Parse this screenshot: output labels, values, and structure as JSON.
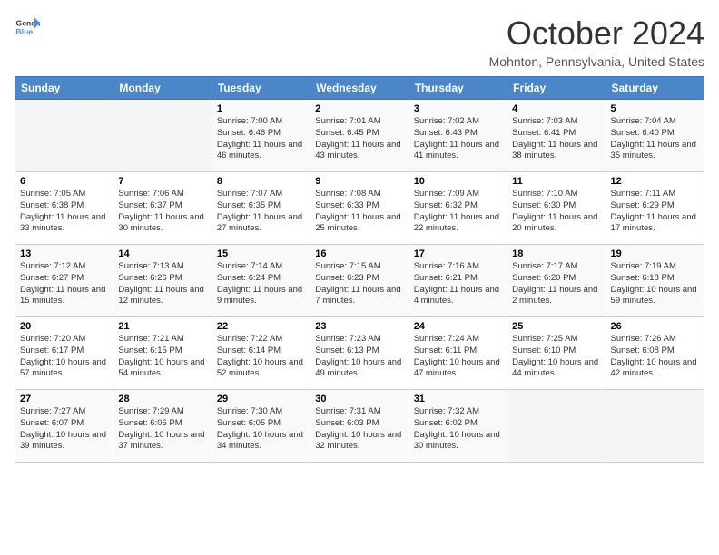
{
  "header": {
    "logo": {
      "general": "General",
      "blue": "Blue"
    },
    "title": "October 2024",
    "location": "Mohnton, Pennsylvania, United States"
  },
  "weekdays": [
    "Sunday",
    "Monday",
    "Tuesday",
    "Wednesday",
    "Thursday",
    "Friday",
    "Saturday"
  ],
  "weeks": [
    [
      {
        "day": null
      },
      {
        "day": null
      },
      {
        "day": "1",
        "sunrise": "Sunrise: 7:00 AM",
        "sunset": "Sunset: 6:46 PM",
        "daylight": "Daylight: 11 hours and 46 minutes."
      },
      {
        "day": "2",
        "sunrise": "Sunrise: 7:01 AM",
        "sunset": "Sunset: 6:45 PM",
        "daylight": "Daylight: 11 hours and 43 minutes."
      },
      {
        "day": "3",
        "sunrise": "Sunrise: 7:02 AM",
        "sunset": "Sunset: 6:43 PM",
        "daylight": "Daylight: 11 hours and 41 minutes."
      },
      {
        "day": "4",
        "sunrise": "Sunrise: 7:03 AM",
        "sunset": "Sunset: 6:41 PM",
        "daylight": "Daylight: 11 hours and 38 minutes."
      },
      {
        "day": "5",
        "sunrise": "Sunrise: 7:04 AM",
        "sunset": "Sunset: 6:40 PM",
        "daylight": "Daylight: 11 hours and 35 minutes."
      }
    ],
    [
      {
        "day": "6",
        "sunrise": "Sunrise: 7:05 AM",
        "sunset": "Sunset: 6:38 PM",
        "daylight": "Daylight: 11 hours and 33 minutes."
      },
      {
        "day": "7",
        "sunrise": "Sunrise: 7:06 AM",
        "sunset": "Sunset: 6:37 PM",
        "daylight": "Daylight: 11 hours and 30 minutes."
      },
      {
        "day": "8",
        "sunrise": "Sunrise: 7:07 AM",
        "sunset": "Sunset: 6:35 PM",
        "daylight": "Daylight: 11 hours and 27 minutes."
      },
      {
        "day": "9",
        "sunrise": "Sunrise: 7:08 AM",
        "sunset": "Sunset: 6:33 PM",
        "daylight": "Daylight: 11 hours and 25 minutes."
      },
      {
        "day": "10",
        "sunrise": "Sunrise: 7:09 AM",
        "sunset": "Sunset: 6:32 PM",
        "daylight": "Daylight: 11 hours and 22 minutes."
      },
      {
        "day": "11",
        "sunrise": "Sunrise: 7:10 AM",
        "sunset": "Sunset: 6:30 PM",
        "daylight": "Daylight: 11 hours and 20 minutes."
      },
      {
        "day": "12",
        "sunrise": "Sunrise: 7:11 AM",
        "sunset": "Sunset: 6:29 PM",
        "daylight": "Daylight: 11 hours and 17 minutes."
      }
    ],
    [
      {
        "day": "13",
        "sunrise": "Sunrise: 7:12 AM",
        "sunset": "Sunset: 6:27 PM",
        "daylight": "Daylight: 11 hours and 15 minutes."
      },
      {
        "day": "14",
        "sunrise": "Sunrise: 7:13 AM",
        "sunset": "Sunset: 6:26 PM",
        "daylight": "Daylight: 11 hours and 12 minutes."
      },
      {
        "day": "15",
        "sunrise": "Sunrise: 7:14 AM",
        "sunset": "Sunset: 6:24 PM",
        "daylight": "Daylight: 11 hours and 9 minutes."
      },
      {
        "day": "16",
        "sunrise": "Sunrise: 7:15 AM",
        "sunset": "Sunset: 6:23 PM",
        "daylight": "Daylight: 11 hours and 7 minutes."
      },
      {
        "day": "17",
        "sunrise": "Sunrise: 7:16 AM",
        "sunset": "Sunset: 6:21 PM",
        "daylight": "Daylight: 11 hours and 4 minutes."
      },
      {
        "day": "18",
        "sunrise": "Sunrise: 7:17 AM",
        "sunset": "Sunset: 6:20 PM",
        "daylight": "Daylight: 11 hours and 2 minutes."
      },
      {
        "day": "19",
        "sunrise": "Sunrise: 7:19 AM",
        "sunset": "Sunset: 6:18 PM",
        "daylight": "Daylight: 10 hours and 59 minutes."
      }
    ],
    [
      {
        "day": "20",
        "sunrise": "Sunrise: 7:20 AM",
        "sunset": "Sunset: 6:17 PM",
        "daylight": "Daylight: 10 hours and 57 minutes."
      },
      {
        "day": "21",
        "sunrise": "Sunrise: 7:21 AM",
        "sunset": "Sunset: 6:15 PM",
        "daylight": "Daylight: 10 hours and 54 minutes."
      },
      {
        "day": "22",
        "sunrise": "Sunrise: 7:22 AM",
        "sunset": "Sunset: 6:14 PM",
        "daylight": "Daylight: 10 hours and 52 minutes."
      },
      {
        "day": "23",
        "sunrise": "Sunrise: 7:23 AM",
        "sunset": "Sunset: 6:13 PM",
        "daylight": "Daylight: 10 hours and 49 minutes."
      },
      {
        "day": "24",
        "sunrise": "Sunrise: 7:24 AM",
        "sunset": "Sunset: 6:11 PM",
        "daylight": "Daylight: 10 hours and 47 minutes."
      },
      {
        "day": "25",
        "sunrise": "Sunrise: 7:25 AM",
        "sunset": "Sunset: 6:10 PM",
        "daylight": "Daylight: 10 hours and 44 minutes."
      },
      {
        "day": "26",
        "sunrise": "Sunrise: 7:26 AM",
        "sunset": "Sunset: 6:08 PM",
        "daylight": "Daylight: 10 hours and 42 minutes."
      }
    ],
    [
      {
        "day": "27",
        "sunrise": "Sunrise: 7:27 AM",
        "sunset": "Sunset: 6:07 PM",
        "daylight": "Daylight: 10 hours and 39 minutes."
      },
      {
        "day": "28",
        "sunrise": "Sunrise: 7:29 AM",
        "sunset": "Sunset: 6:06 PM",
        "daylight": "Daylight: 10 hours and 37 minutes."
      },
      {
        "day": "29",
        "sunrise": "Sunrise: 7:30 AM",
        "sunset": "Sunset: 6:05 PM",
        "daylight": "Daylight: 10 hours and 34 minutes."
      },
      {
        "day": "30",
        "sunrise": "Sunrise: 7:31 AM",
        "sunset": "Sunset: 6:03 PM",
        "daylight": "Daylight: 10 hours and 32 minutes."
      },
      {
        "day": "31",
        "sunrise": "Sunrise: 7:32 AM",
        "sunset": "Sunset: 6:02 PM",
        "daylight": "Daylight: 10 hours and 30 minutes."
      },
      {
        "day": null
      },
      {
        "day": null
      }
    ]
  ]
}
